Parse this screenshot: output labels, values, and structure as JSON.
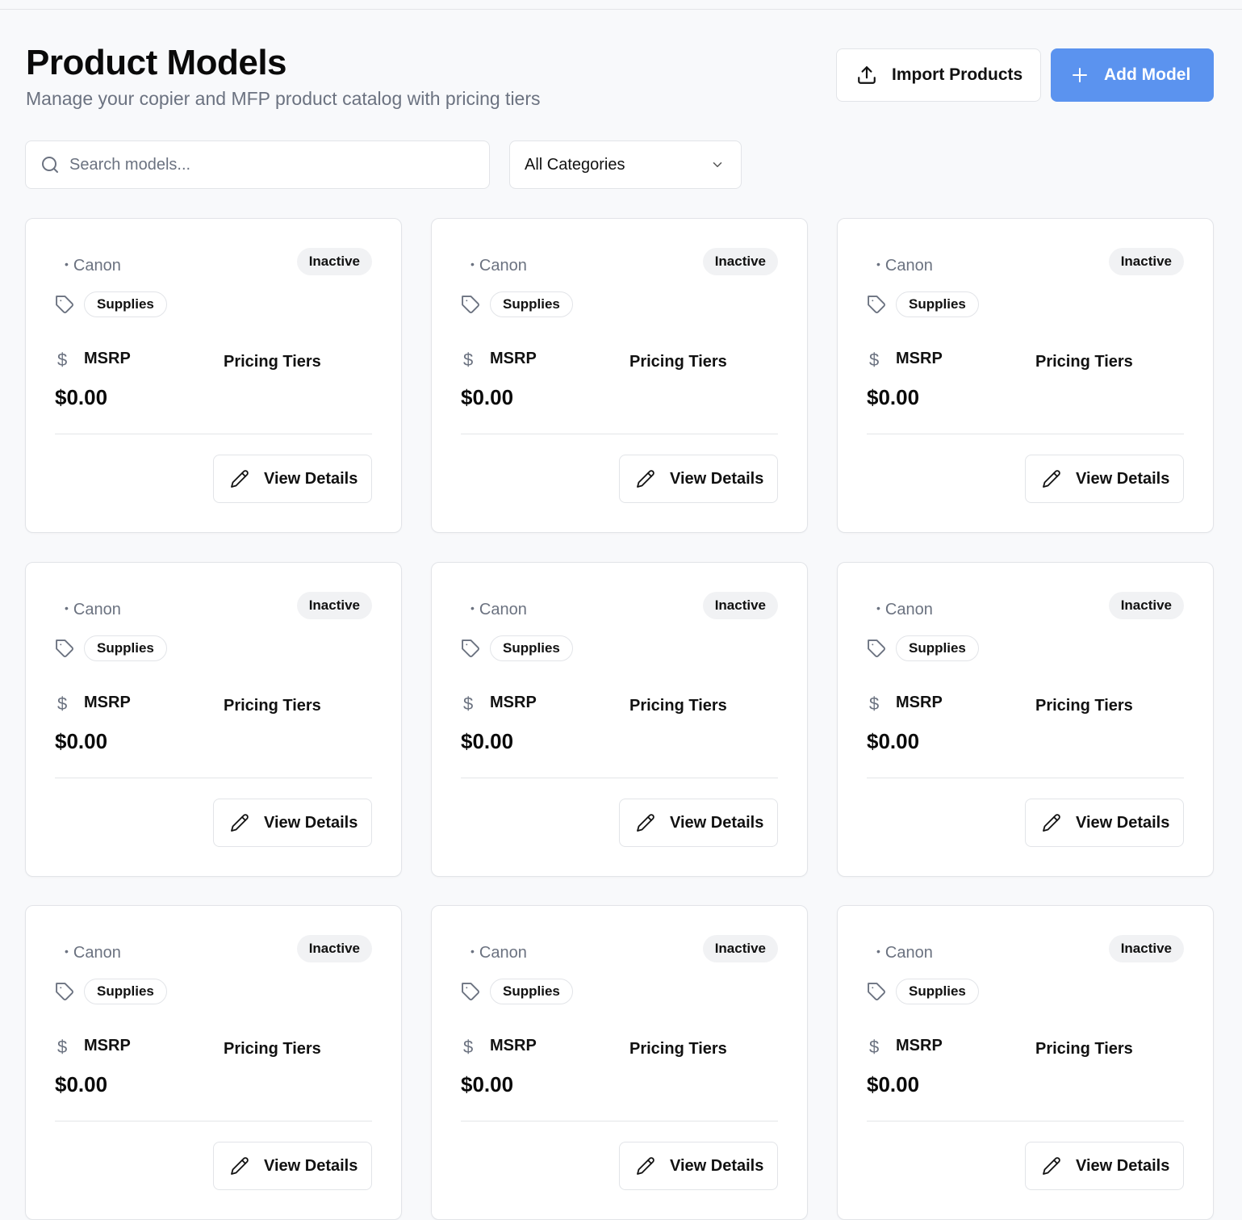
{
  "header": {
    "title": "Product Models",
    "subtitle": "Manage your copier and MFP product catalog with pricing tiers"
  },
  "actions": {
    "import_label": "Import Products",
    "add_label": "Add Model",
    "import_icon": "upload-icon",
    "add_icon": "plus-icon"
  },
  "filters": {
    "search_placeholder": "Search models...",
    "search_value": "",
    "category_selected": "All Categories"
  },
  "colors": {
    "accent": "#5b93ef",
    "badge_bg": "#f1f2f4",
    "muted_text": "#6b7280"
  },
  "cards": [
    {
      "brand": "Canon",
      "status": "Inactive",
      "category": "Supplies",
      "msrp_label": "MSRP",
      "msrp_value": "$0.00",
      "tiers_label": "Pricing Tiers",
      "action_label": "View Details"
    },
    {
      "brand": "Canon",
      "status": "Inactive",
      "category": "Supplies",
      "msrp_label": "MSRP",
      "msrp_value": "$0.00",
      "tiers_label": "Pricing Tiers",
      "action_label": "View Details"
    },
    {
      "brand": "Canon",
      "status": "Inactive",
      "category": "Supplies",
      "msrp_label": "MSRP",
      "msrp_value": "$0.00",
      "tiers_label": "Pricing Tiers",
      "action_label": "View Details"
    },
    {
      "brand": "Canon",
      "status": "Inactive",
      "category": "Supplies",
      "msrp_label": "MSRP",
      "msrp_value": "$0.00",
      "tiers_label": "Pricing Tiers",
      "action_label": "View Details"
    },
    {
      "brand": "Canon",
      "status": "Inactive",
      "category": "Supplies",
      "msrp_label": "MSRP",
      "msrp_value": "$0.00",
      "tiers_label": "Pricing Tiers",
      "action_label": "View Details"
    },
    {
      "brand": "Canon",
      "status": "Inactive",
      "category": "Supplies",
      "msrp_label": "MSRP",
      "msrp_value": "$0.00",
      "tiers_label": "Pricing Tiers",
      "action_label": "View Details"
    },
    {
      "brand": "Canon",
      "status": "Inactive",
      "category": "Supplies",
      "msrp_label": "MSRP",
      "msrp_value": "$0.00",
      "tiers_label": "Pricing Tiers",
      "action_label": "View Details"
    },
    {
      "brand": "Canon",
      "status": "Inactive",
      "category": "Supplies",
      "msrp_label": "MSRP",
      "msrp_value": "$0.00",
      "tiers_label": "Pricing Tiers",
      "action_label": "View Details"
    },
    {
      "brand": "Canon",
      "status": "Inactive",
      "category": "Supplies",
      "msrp_label": "MSRP",
      "msrp_value": "$0.00",
      "tiers_label": "Pricing Tiers",
      "action_label": "View Details"
    }
  ]
}
